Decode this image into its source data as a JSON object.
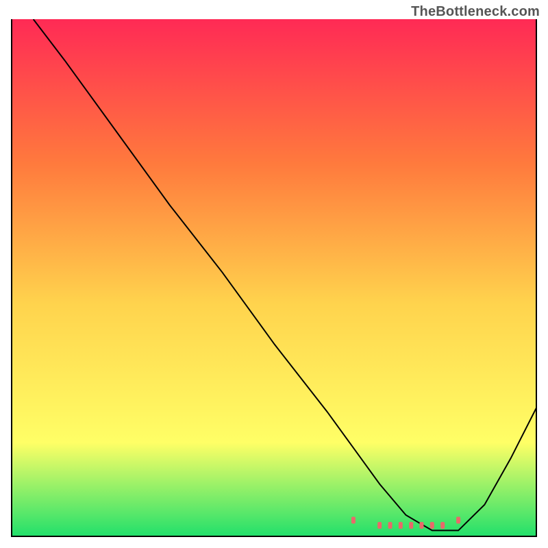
{
  "watermark": "TheBottleneck.com",
  "chart_data": {
    "type": "line",
    "title": "",
    "xlabel": "",
    "ylabel": "",
    "xlim": [
      0,
      100
    ],
    "ylim": [
      0,
      100
    ],
    "background_gradient": {
      "top": "#ff2a55",
      "mid_upper": "#ff7a3d",
      "mid": "#ffd34d",
      "mid_lower": "#ffff66",
      "bottom": "#23e06b"
    },
    "series": [
      {
        "name": "bottleneck-curve",
        "color": "#000000",
        "x": [
          4,
          10,
          20,
          30,
          40,
          50,
          60,
          65,
          70,
          75,
          80,
          82,
          85,
          90,
          95,
          100
        ],
        "y": [
          100,
          92,
          78,
          64,
          51,
          37,
          24,
          17,
          10,
          4,
          1,
          1,
          1,
          6,
          15,
          25
        ]
      },
      {
        "name": "optimal-range-markers",
        "color": "#e86a6a",
        "type": "scatter",
        "x": [
          65,
          70,
          72,
          74,
          76,
          78,
          80,
          82,
          85
        ],
        "y": [
          3,
          2,
          2,
          2,
          2,
          2,
          2,
          2,
          3
        ]
      }
    ],
    "annotations": []
  }
}
